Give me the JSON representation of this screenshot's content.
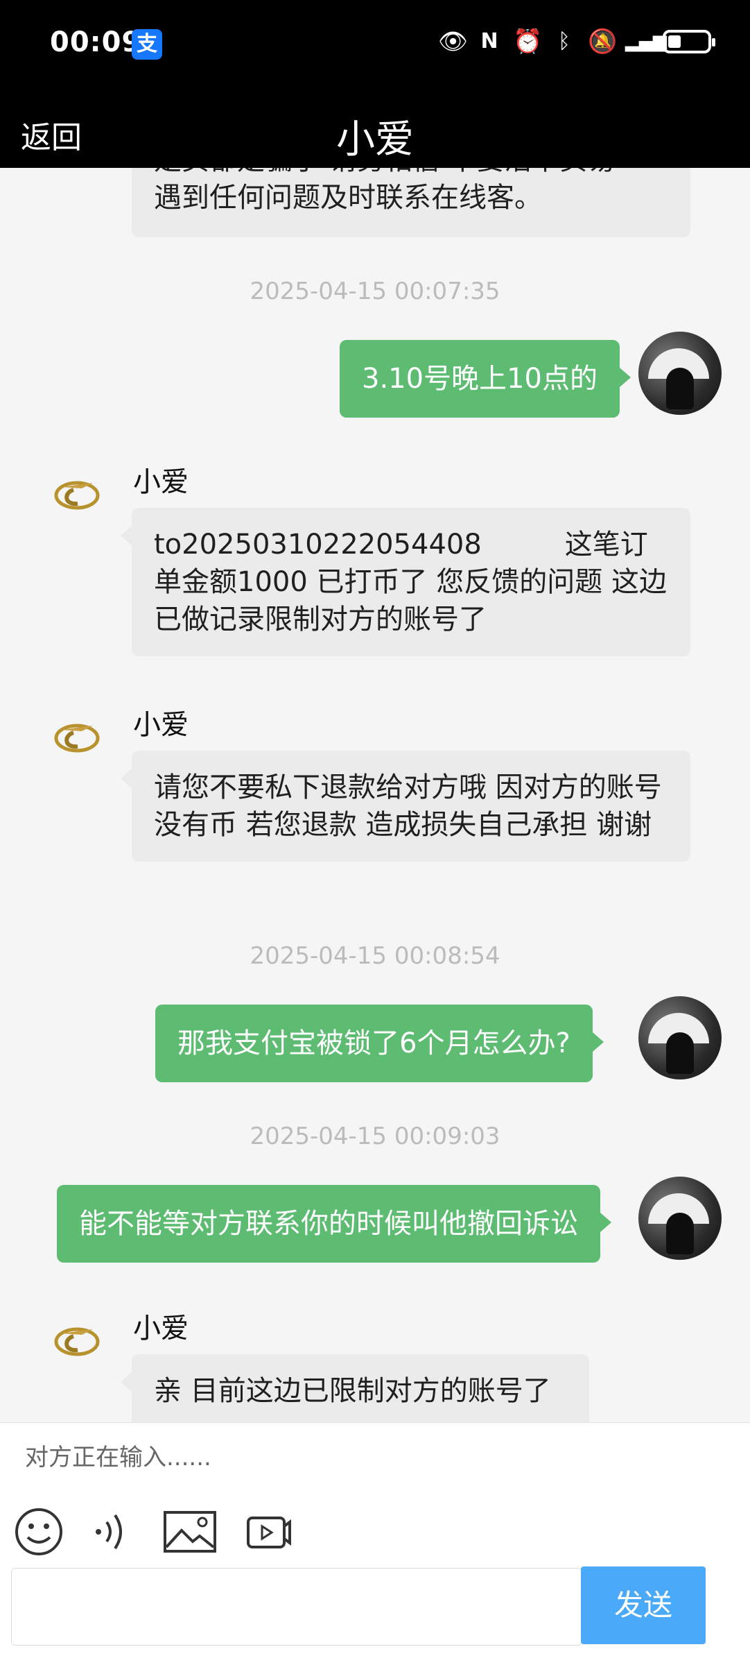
{
  "status_bar": {
    "time": "00:09",
    "app_badge": "支"
  },
  "header": {
    "back_label": "返回",
    "title": "小爱"
  },
  "messages": {
    "partial_first": "遇到任何问题及时联系在线客。",
    "partial_first_cut": "是买都是骗子  请务相信  本要活下买易",
    "ts1": "2025-04-15 00:07:35",
    "out1": "3.10号晚上10点的",
    "sender1": "小爱",
    "in1": "to20250310222054408　　　这笔订单金额1000 已打币了 您反馈的问题 这边已做记录限制对方的账号了",
    "sender2": "小爱",
    "in2": "请您不要私下退款给对方哦 因对方的账号没有币 若您退款 造成损失自己承担 谢谢",
    "ts2": "2025-04-15 00:08:54",
    "out2": "那我支付宝被锁了6个月怎么办?",
    "ts3": "2025-04-15 00:09:03",
    "out3": "能不能等对方联系你的时候叫他撤回诉讼",
    "sender3": "小爱",
    "in3": "亲 目前这边已限制对方的账号了"
  },
  "typing_indicator": "对方正在输入......",
  "composer": {
    "send_label": "发送",
    "input_value": ""
  },
  "colors": {
    "outgoing": "#5dbc72",
    "incoming": "#ebebeb",
    "send": "#4aa9f8"
  }
}
